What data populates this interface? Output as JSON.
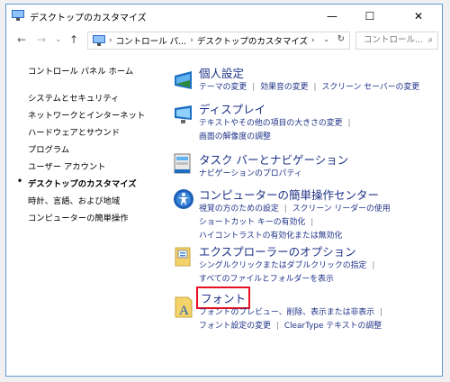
{
  "window": {
    "title": "デスクトップのカスタマイズ",
    "controls": {
      "minimize": "—",
      "maximize": "☐",
      "close": "✕"
    }
  },
  "nav": {
    "back": "←",
    "forward": "→",
    "recent": "⌄",
    "up": "↑",
    "breadcrumbs": [
      "コントロール パ...",
      "デスクトップのカスタマイズ"
    ],
    "separator": "›",
    "dropdown": "⌄",
    "refresh": "↻",
    "search_placeholder": "コントロール...",
    "search_icon": "⌕"
  },
  "sidebar": {
    "home": "コントロール パネル ホーム",
    "items": [
      {
        "label": "システムとセキュリティ"
      },
      {
        "label": "ネットワークとインターネット"
      },
      {
        "label": "ハードウェアとサウンド"
      },
      {
        "label": "プログラム"
      },
      {
        "label": "ユーザー アカウント"
      },
      {
        "label": "デスクトップのカスタマイズ",
        "current": true
      },
      {
        "label": "時計、言語、および地域"
      },
      {
        "label": "コンピューターの簡単操作"
      }
    ],
    "bullet": "•"
  },
  "categories": [
    {
      "title": "個人設定",
      "icon": "personalization-icon",
      "links": [
        "テーマの変更",
        "効果音の変更",
        "スクリーン セーバーの変更"
      ]
    },
    {
      "title": "ディスプレイ",
      "icon": "display-icon",
      "links": [
        "テキストやその他の項目の大きさの変更",
        "画面の解像度の調整"
      ]
    },
    {
      "title": "タスク バーとナビゲーション",
      "icon": "taskbar-icon",
      "links": [
        "ナビゲーションのプロパティ"
      ]
    },
    {
      "title": "コンピューターの簡単操作センター",
      "icon": "ease-of-access-icon",
      "links": [
        "視覚の方のための設定",
        "スクリーン リーダーの使用",
        "ショートカット キーの有効化",
        "ハイコントラストの有効化または無効化"
      ]
    },
    {
      "title": "エクスプローラーのオプション",
      "icon": "folder-options-icon",
      "links": [
        "シングルクリックまたはダブルクリックの指定",
        "すべてのファイルとフォルダーを表示"
      ]
    },
    {
      "title": "フォント",
      "icon": "fonts-icon",
      "highlighted": true,
      "highlight_color": "#e81123",
      "links": [
        "フォントのプレビュー、削除、表示または非表示",
        "フォント設定の変更",
        "ClearType テキストの調整"
      ]
    }
  ],
  "colors": {
    "link": "#1e3287",
    "highlight": "#e81123",
    "window_border": "#5b9bd5"
  }
}
